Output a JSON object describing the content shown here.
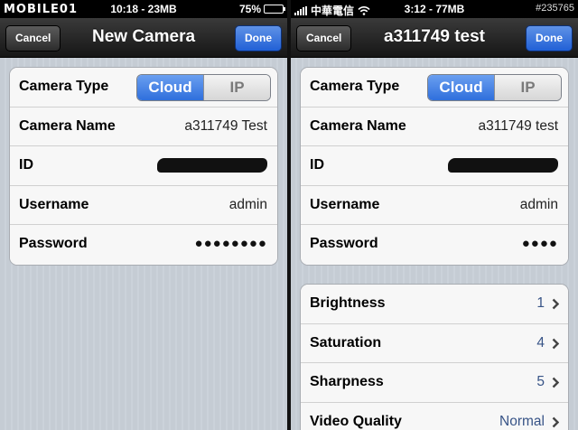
{
  "left": {
    "status": {
      "watermark": "MOBILE01",
      "time": "10:18 - 23MB",
      "battery_label": "75%",
      "battery_level": 0.75
    },
    "nav": {
      "cancel": "Cancel",
      "title": "New Camera",
      "done": "Done"
    },
    "form": {
      "camera_type_label": "Camera Type",
      "seg_cloud": "Cloud",
      "seg_ip": "IP",
      "camera_name_label": "Camera Name",
      "camera_name_value": "a311749 Test",
      "id_label": "ID",
      "username_label": "Username",
      "username_value": "admin",
      "password_label": "Password",
      "password_value": "●●●●●●●●"
    }
  },
  "right": {
    "status": {
      "carrier": "中華電信",
      "time": "3:12 - 77MB",
      "watermark_id": "#235765"
    },
    "nav": {
      "cancel": "Cancel",
      "title": "a311749 test",
      "done": "Done"
    },
    "form": {
      "camera_type_label": "Camera Type",
      "seg_cloud": "Cloud",
      "seg_ip": "IP",
      "camera_name_label": "Camera Name",
      "camera_name_value": "a311749 test",
      "id_label": "ID",
      "username_label": "Username",
      "username_value": "admin",
      "password_label": "Password",
      "password_value": "●●●●"
    },
    "settings": {
      "brightness_label": "Brightness",
      "brightness_value": "1",
      "saturation_label": "Saturation",
      "saturation_value": "4",
      "sharpness_label": "Sharpness",
      "sharpness_value": "5",
      "video_quality_label": "Video Quality",
      "video_quality_value": "Normal"
    }
  },
  "colors": {
    "accent_blue": "#2f6fdc",
    "value_blue": "#385487",
    "background": "#c5ccd4"
  },
  "icons": [
    "chevron-right-icon",
    "battery-icon",
    "signal-icon",
    "wifi-icon"
  ]
}
